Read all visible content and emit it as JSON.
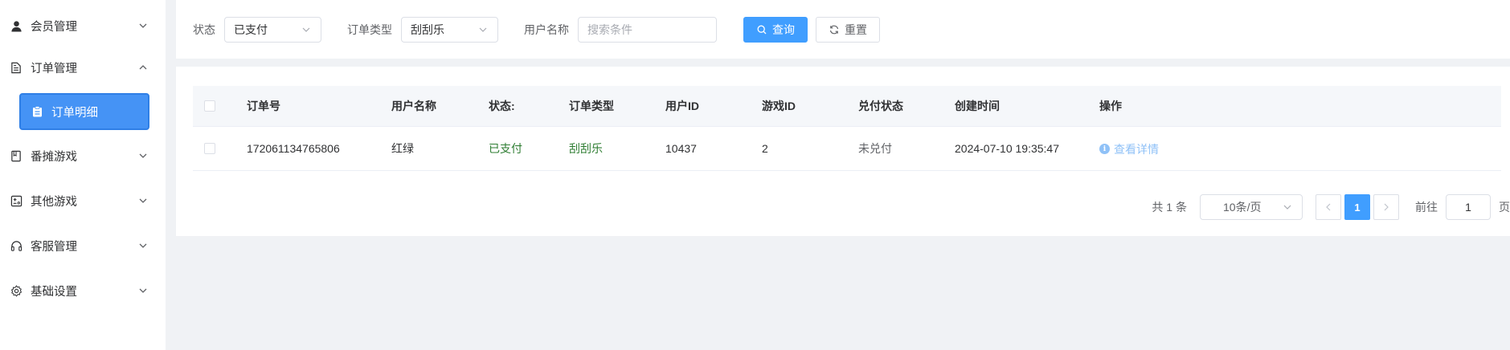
{
  "sidebar": {
    "items": [
      {
        "label": "会员管理",
        "icon": "user-icon"
      },
      {
        "label": "订单管理",
        "icon": "document-icon"
      },
      {
        "label": "订单明细",
        "icon": "clipboard-icon"
      },
      {
        "label": "番摊游戏",
        "icon": "book-icon"
      },
      {
        "label": "其他游戏",
        "icon": "game-icon"
      },
      {
        "label": "客服管理",
        "icon": "headset-icon"
      },
      {
        "label": "基础设置",
        "icon": "gear-icon"
      }
    ]
  },
  "filters": {
    "status_label": "状态",
    "status_value": "已支付",
    "type_label": "订单类型",
    "type_value": "刮刮乐",
    "username_label": "用户名称",
    "username_placeholder": "搜索条件",
    "search_label": "查询",
    "reset_label": "重置"
  },
  "table": {
    "headers": [
      "订单号",
      "用户名称",
      "状态:",
      "订单类型",
      "用户ID",
      "游戏ID",
      "兑付状态",
      "创建时间",
      "操作"
    ],
    "rows": [
      {
        "order_no": "172061134765806",
        "username": "红绿",
        "status": "已支付",
        "type": "刮刮乐",
        "user_id": "10437",
        "game_id": "2",
        "redeem_status": "未兑付",
        "created": "2024-07-10 19:35:47",
        "action": "查看详情"
      }
    ]
  },
  "pagination": {
    "total": "共 1 条",
    "page_size": "10条/页",
    "current_page": "1",
    "goto_label": "前往",
    "goto_value": "1",
    "page_suffix": "页"
  },
  "colors": {
    "primary": "#409eff",
    "active_menu": "#4593f5",
    "paid_status": "#2e7d32",
    "link": "#8fc1f7"
  }
}
